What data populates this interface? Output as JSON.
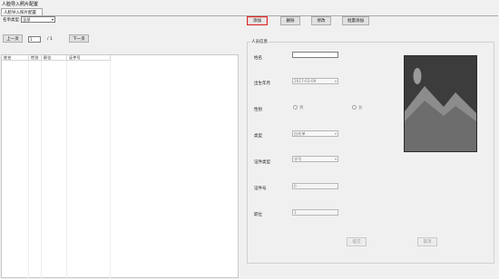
{
  "window": {
    "title": "人脸导入照片配置",
    "tab": "人脸导入照片配置"
  },
  "filter": {
    "label": "名单类型",
    "value": "全部"
  },
  "pager": {
    "prev": "上一页",
    "current": "1",
    "total": "/ 1",
    "next": "下一页"
  },
  "table": {
    "columns": [
      "姓名",
      "性别",
      "职位",
      "证件号"
    ]
  },
  "toolbar": {
    "add": "添加",
    "delete": "删除",
    "modify": "修改",
    "batch_add": "批量添加"
  },
  "form": {
    "group_title": "人员信息",
    "name_label": "姓名",
    "name_value": "",
    "birth_label": "出生年月",
    "birth_value": "2017-03-09",
    "gender_label": "性别",
    "gender_male": "男",
    "gender_female": "女",
    "type_label": "类型",
    "type_value": "白名单",
    "idtype_label": "证件类型",
    "idtype_value": "学号",
    "idno_label": "证件号",
    "idno_value": "0",
    "position_label": "职位",
    "position_value": "1",
    "submit": "提交",
    "cancel": "取消"
  },
  "colors": {
    "focus_border": "#d62a2a",
    "photo_bg": "#3c3c3c"
  }
}
